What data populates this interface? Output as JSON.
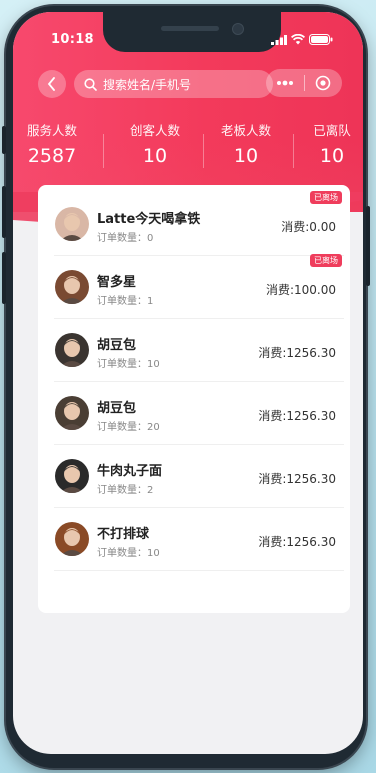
{
  "status_bar": {
    "time": "10:18"
  },
  "search": {
    "placeholder": "搜索姓名/手机号"
  },
  "stats": [
    {
      "label": "服务人数",
      "value": "2587"
    },
    {
      "label": "创客人数",
      "value": "10"
    },
    {
      "label": "老板人数",
      "value": "10"
    },
    {
      "label": "已离队",
      "value": "10"
    }
  ],
  "members": [
    {
      "name": "Latte今天喝拿铁",
      "orders": "订单数量：0",
      "spend": "消费:0.00",
      "tag": "已离场",
      "avatar_color": "#d9b7a6"
    },
    {
      "name": "智多星",
      "orders": "订单数量：1",
      "spend": "消费:100.00",
      "tag": "已离场",
      "avatar_color": "#7a4a32"
    },
    {
      "name": "胡豆包",
      "orders": "订单数量：10",
      "spend": "消费:1256.30",
      "tag": "",
      "avatar_color": "#3a3430"
    },
    {
      "name": "胡豆包",
      "orders": "订单数量：20",
      "spend": "消费:1256.30",
      "tag": "",
      "avatar_color": "#4a3e34"
    },
    {
      "name": "牛肉丸子面",
      "orders": "订单数量：2",
      "spend": "消费:1256.30",
      "tag": "",
      "avatar_color": "#2a2a2a"
    },
    {
      "name": "不打排球",
      "orders": "订单数量：10",
      "spend": "消费:1256.30",
      "tag": "",
      "avatar_color": "#8a4a26"
    }
  ],
  "colors": {
    "brand": "#f33a5b",
    "tag": "#ef3d5c"
  }
}
